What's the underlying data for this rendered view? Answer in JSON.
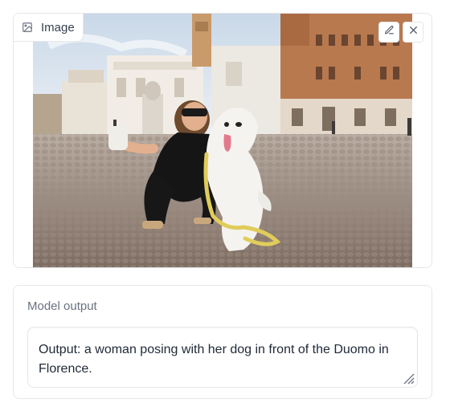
{
  "image_component": {
    "label": "Image",
    "label_icon": "image-icon",
    "edit_icon": "pencil-icon",
    "clear_icon": "close-icon"
  },
  "output_component": {
    "label": "Model output",
    "value": "Output: a woman posing with her dog in front of the Duomo in Florence."
  },
  "colors": {
    "border": "#e5e7eb",
    "label_text": "#6b7280",
    "body_text": "#1f2937",
    "sky": "#dbe6f0",
    "pavement": "#8f7f74"
  }
}
